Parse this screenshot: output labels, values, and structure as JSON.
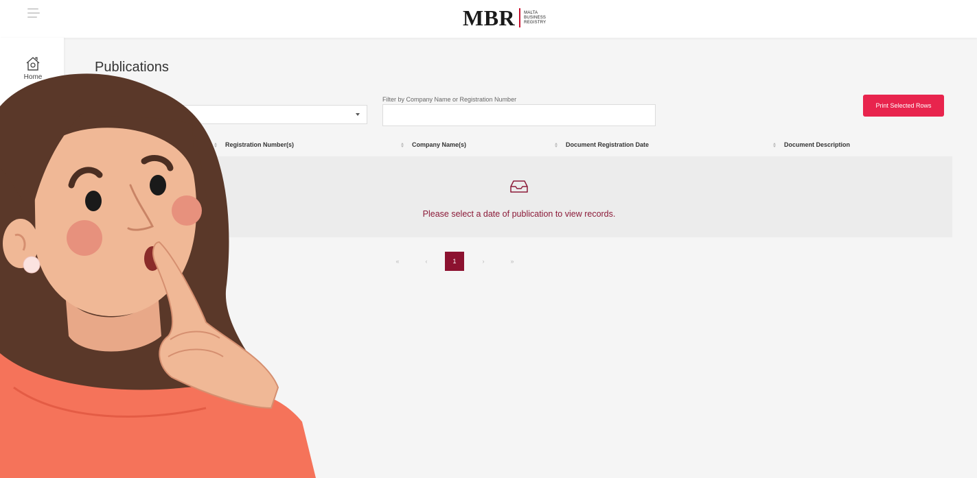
{
  "header": {
    "logo_main": "MBR",
    "logo_sub": [
      "MALTA",
      "BUSINESS",
      "REGISTRY"
    ]
  },
  "sidebar": {
    "items": [
      {
        "label": "Home",
        "icon": "home-icon"
      }
    ]
  },
  "page": {
    "title": "Publications"
  },
  "filters": {
    "date_select_value": "",
    "company_filter_label": "Filter by Company Name or Registration Number",
    "company_filter_value": "",
    "print_button": "Print Selected Rows"
  },
  "table": {
    "columns": [
      "Registration Number(s)",
      "Company Name(s)",
      "Document Registration Date",
      "Document Description"
    ],
    "empty_message": "Please select a date of publication to view records.",
    "empty_icon": "inbox-icon"
  },
  "pagination": {
    "first": "«",
    "prev": "‹",
    "current": "1",
    "next": "›",
    "last": "»"
  },
  "colors": {
    "accent": "#e8244d",
    "brand": "#8c1230",
    "empty_text": "#8b1a38",
    "background": "#f5f5f5"
  }
}
